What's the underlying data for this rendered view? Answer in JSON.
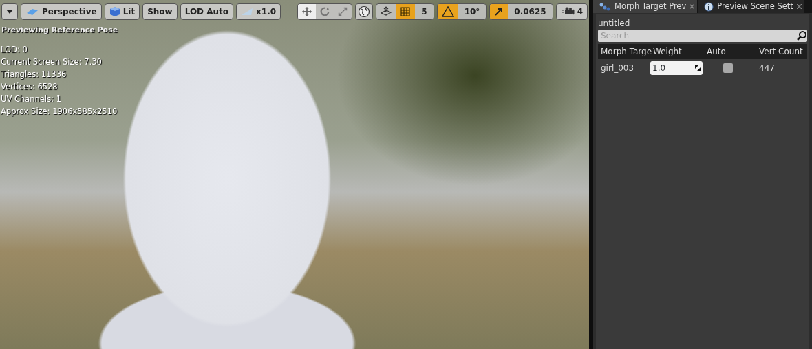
{
  "viewport": {
    "toolbar_left": [
      {
        "kind": "dropdown"
      },
      {
        "kind": "button",
        "label": "Perspective"
      },
      {
        "kind": "button",
        "label": "Lit"
      },
      {
        "kind": "button",
        "label": "Show"
      },
      {
        "kind": "button",
        "label": "LOD Auto"
      },
      {
        "kind": "button",
        "label": "x1.0"
      }
    ],
    "transform_modes": [
      {
        "selected": true
      },
      {
        "selected": false
      },
      {
        "selected": false
      }
    ],
    "snaps": [
      {
        "on": true,
        "value": "5"
      },
      {
        "on": true,
        "value": "10°"
      },
      {
        "on": true,
        "value": "0.0625"
      }
    ],
    "camera_speed": "4",
    "pose_label": "Previewing Reference Pose",
    "stats": [
      "LOD: 0",
      "Current Screen Size: 7.30",
      "Triangles: 11336",
      "Vertices: 6528",
      "UV Channels: 1",
      "Approx Size: 1906x585x2510"
    ]
  },
  "panel": {
    "tabs": [
      {
        "label": "Morph Target Prev",
        "selected": true
      },
      {
        "label": "Preview Scene Sett",
        "selected": false
      }
    ],
    "title": "untitled",
    "search": {
      "placeholder": "Search"
    },
    "columns": [
      "Morph Targe",
      "Weight",
      "Auto",
      "Vert Count"
    ],
    "rows": [
      {
        "name": "girl_003",
        "weight": "1.0",
        "auto": false,
        "vert_count": "447"
      }
    ]
  }
}
